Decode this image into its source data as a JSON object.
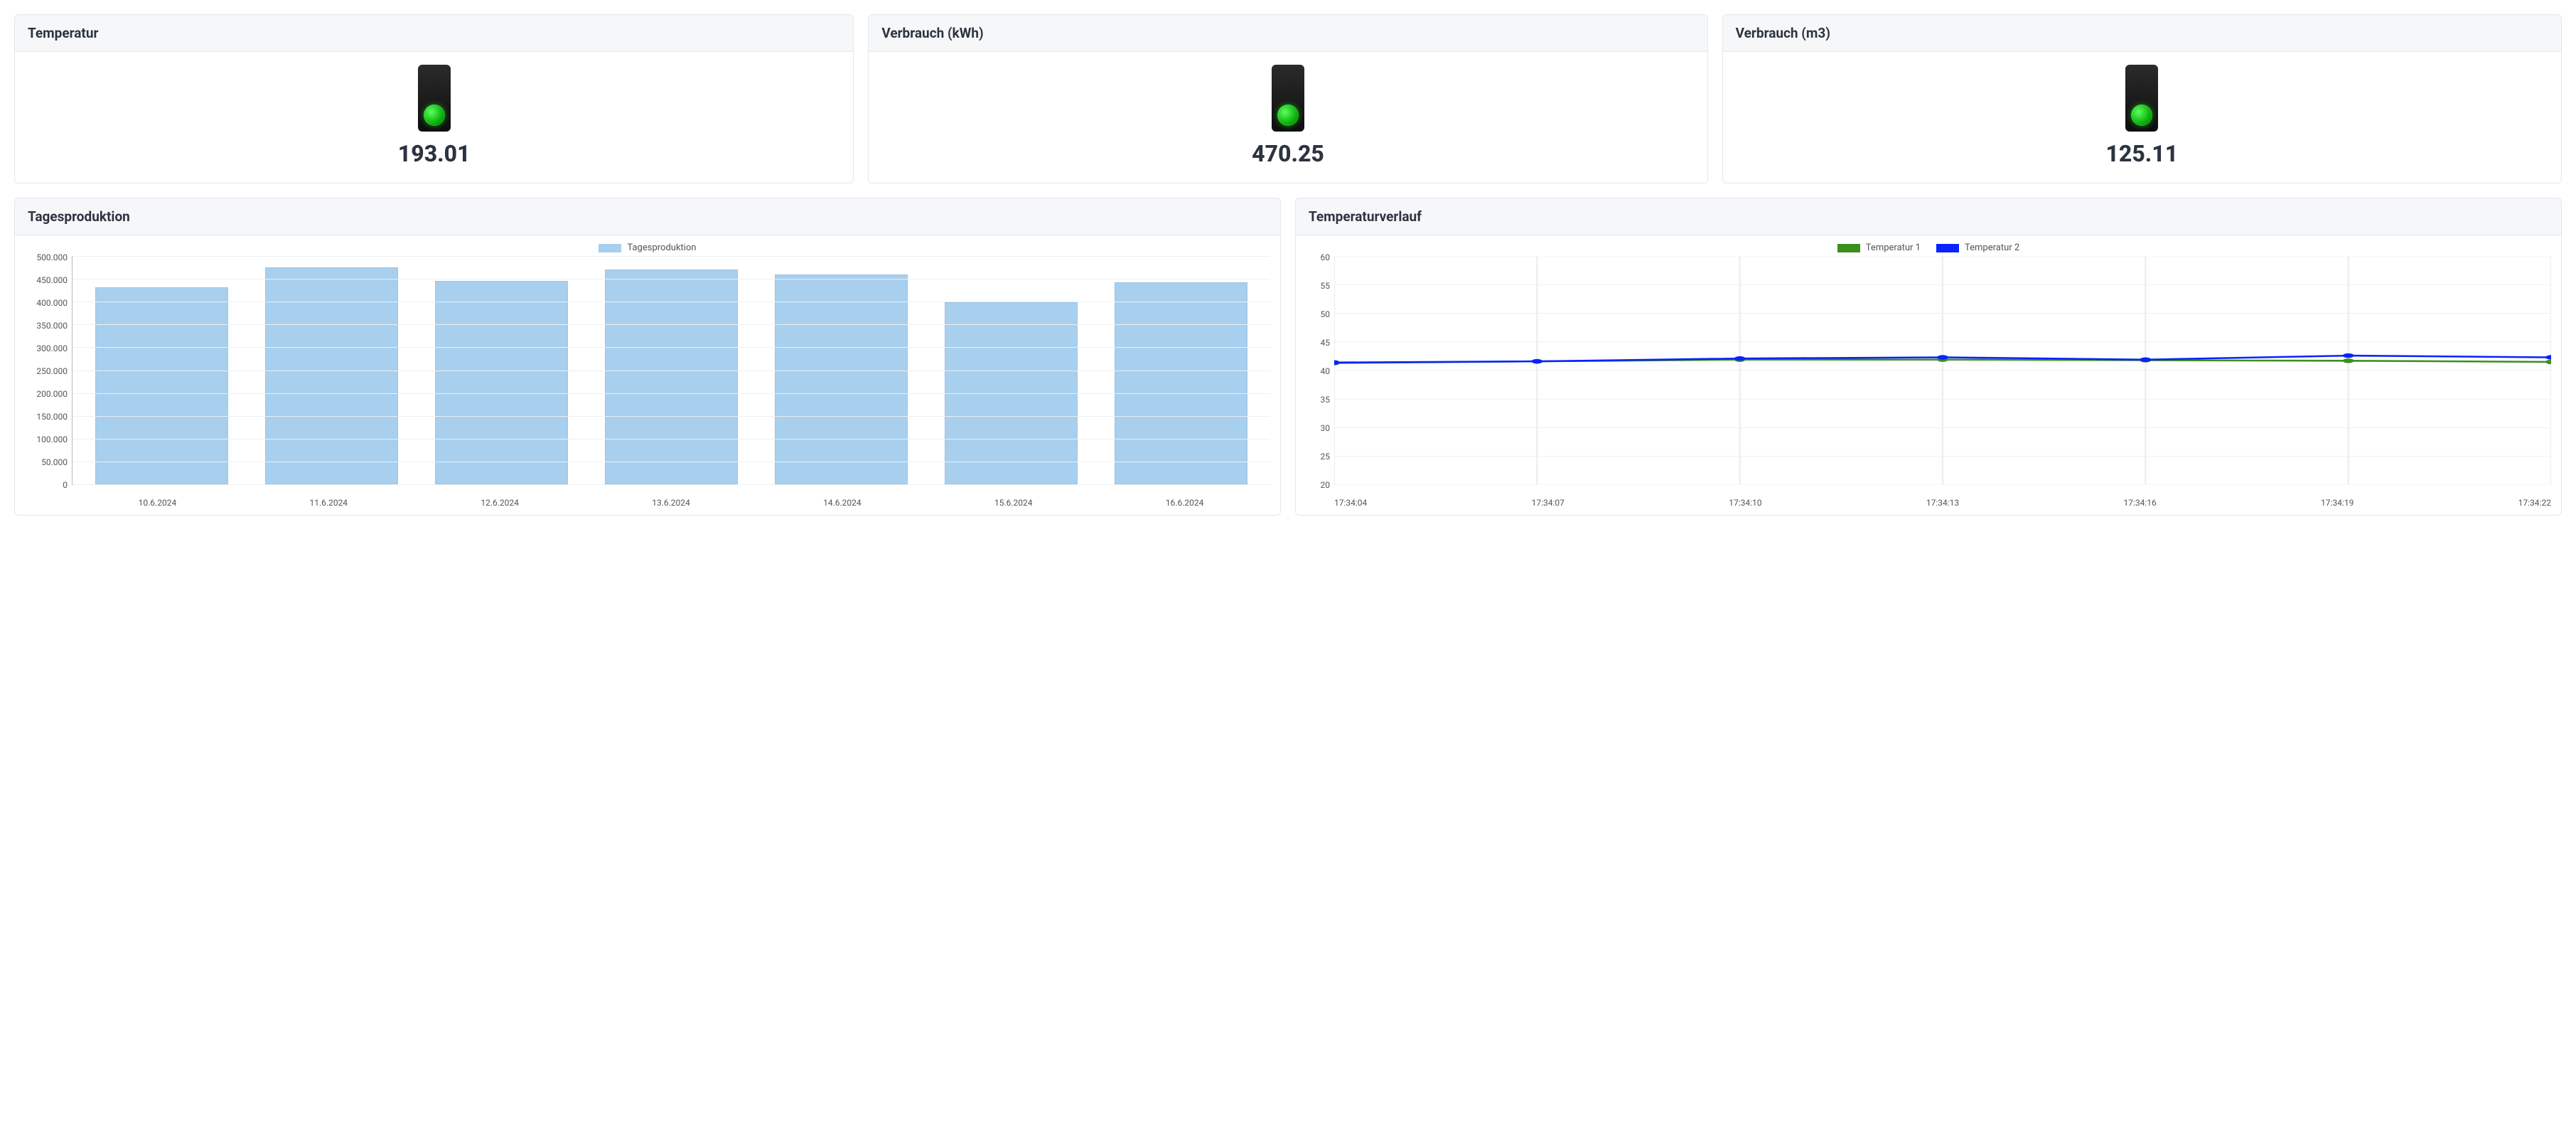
{
  "kpis": [
    {
      "title": "Temperatur",
      "value": "193.01",
      "status": "green"
    },
    {
      "title": "Verbrauch (kWh)",
      "value": "470.25",
      "status": "green"
    },
    {
      "title": "Verbrauch (m3)",
      "value": "125.11",
      "status": "green"
    }
  ],
  "chart_data": [
    {
      "type": "bar",
      "title": "Tagesproduktion",
      "legend": "Tagesproduktion",
      "categories": [
        "10.6.2024",
        "11.6.2024",
        "12.6.2024",
        "13.6.2024",
        "14.6.2024",
        "15.6.2024",
        "16.6.2024"
      ],
      "values": [
        432000,
        475000,
        445000,
        470000,
        460000,
        398000,
        442000
      ],
      "ylim": [
        0,
        500000
      ],
      "y_ticks": [
        "500.000",
        "450.000",
        "400.000",
        "350.000",
        "300.000",
        "250.000",
        "200.000",
        "150.000",
        "100.000",
        "50.000",
        "0"
      ],
      "bar_color": "#a8cfed"
    },
    {
      "type": "line",
      "title": "Temperaturverlauf",
      "x_labels": [
        "17:34:04",
        "17:34:07",
        "17:34:10",
        "17:34:13",
        "17:34:16",
        "17:34:19",
        "17:34:22"
      ],
      "ylim": [
        20,
        60
      ],
      "y_ticks": [
        "60",
        "55",
        "50",
        "45",
        "40",
        "35",
        "30",
        "25",
        "20"
      ],
      "series": [
        {
          "name": "Temperatur 1",
          "color": "#3b8f1e",
          "x": [
            0,
            1,
            2,
            3,
            4,
            5,
            6
          ],
          "values": [
            41.3,
            41.6,
            41.9,
            41.9,
            41.8,
            41.7,
            41.5
          ]
        },
        {
          "name": "Temperatur 2",
          "color": "#0a22ff",
          "x": [
            0,
            1,
            2,
            3,
            4,
            5,
            6
          ],
          "values": [
            41.4,
            41.6,
            42.1,
            42.3,
            41.9,
            42.6,
            42.3
          ]
        }
      ]
    }
  ]
}
